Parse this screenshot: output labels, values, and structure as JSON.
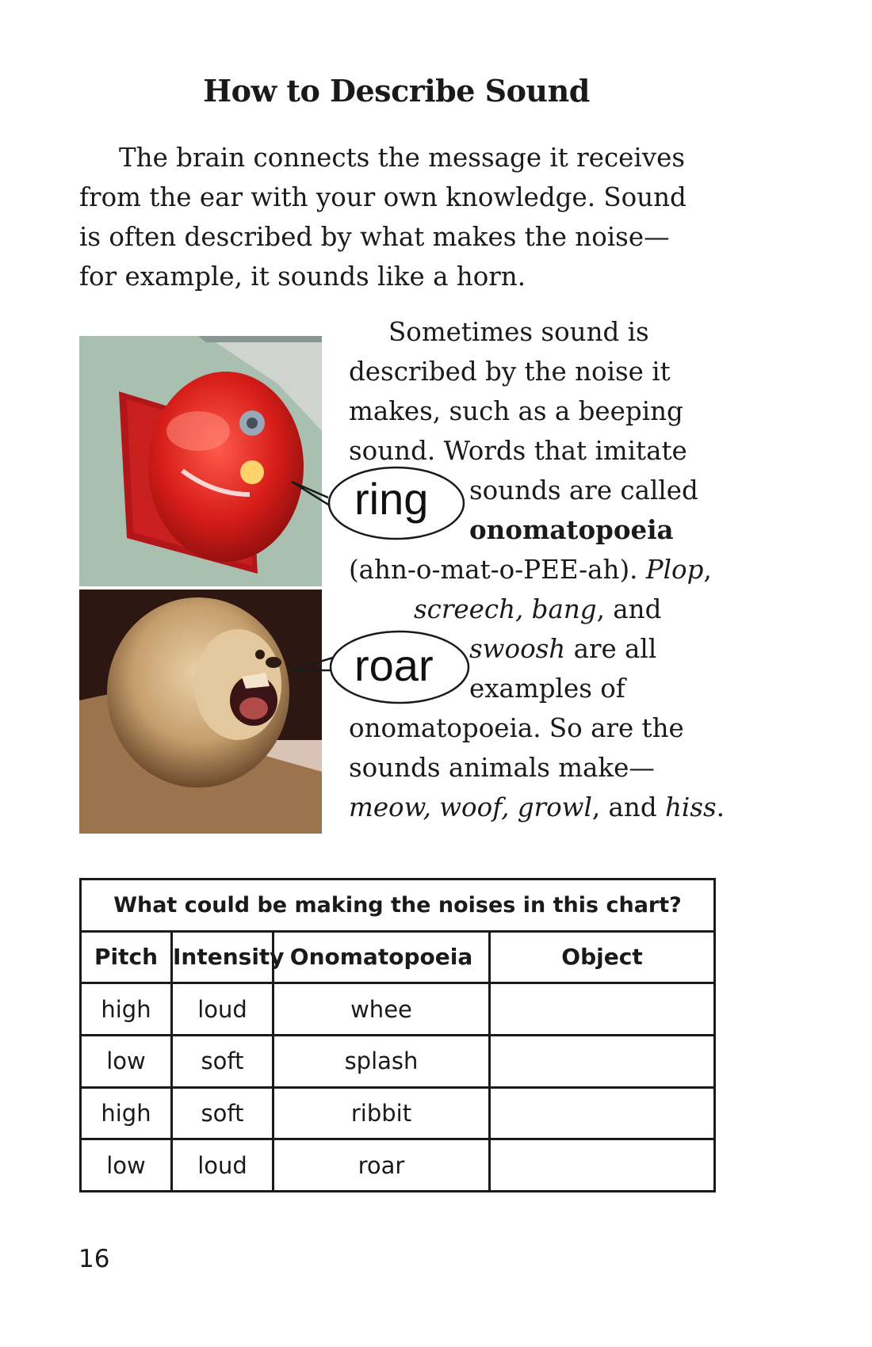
{
  "page": {
    "title": "How to Describe Sound",
    "intro": "The brain connects the message it receives from the ear with your own knowledge. Sound is often described by what makes the noise—for example, it sounds like a horn.",
    "page_number": "16"
  },
  "column_text": {
    "l1": "Sometimes sound is",
    "l2": "described by the noise it",
    "l3": "makes, such as a beeping",
    "l4": "sound. Words that imitate",
    "l5": "sounds are called",
    "l6": "onomatopoeia",
    "l7a": "(ahn-o-mat-o-PEE-ah). ",
    "l7b": "Plop",
    "l7c": ",",
    "l8a": "screech, bang",
    "l8b": ", and",
    "l9a": "swoosh",
    "l9b": " are all",
    "l10": "examples of",
    "l11": "onomatopoeia. So are the",
    "l12": "sounds animals make—",
    "l13a": "meow, woof, growl",
    "l13b": ", and ",
    "l13c": "hiss",
    "l13d": "."
  },
  "bubbles": {
    "ring": "ring",
    "roar": "roar"
  },
  "chart": {
    "caption": "What could be making the noises in this chart?",
    "headers": [
      "Pitch",
      "Intensity",
      "Onomatopoeia",
      "Object"
    ],
    "rows": [
      [
        "high",
        "loud",
        "whee",
        ""
      ],
      [
        "low",
        "soft",
        "splash",
        ""
      ],
      [
        "high",
        "soft",
        "ribbit",
        ""
      ],
      [
        "low",
        "loud",
        "roar",
        ""
      ]
    ]
  },
  "images": {
    "top": "red-bell-photo",
    "bottom": "roaring-lion-photo"
  }
}
